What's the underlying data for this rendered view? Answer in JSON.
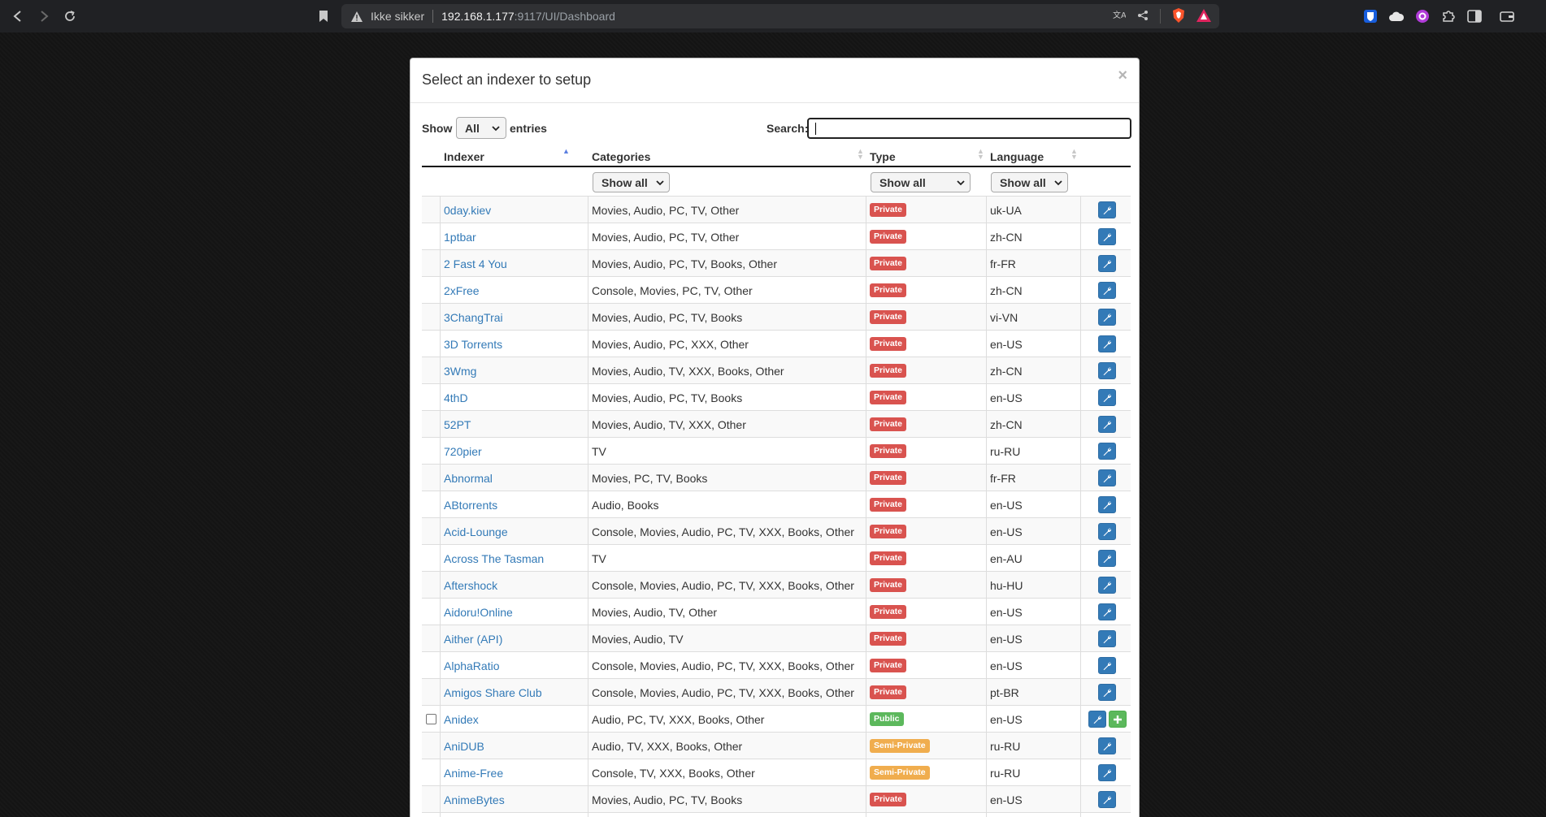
{
  "browser": {
    "security_label": "Ikke sikker",
    "url_host": "192.168.1.177",
    "url_path": ":9117/UI/Dashboard",
    "icons": [
      "back-icon",
      "forward-icon",
      "reload-icon",
      "bookmark-icon",
      "warning-icon",
      "translate-icon",
      "share-icon",
      "brave-shield-icon",
      "brave-rewards-icon",
      "extension-icon",
      "sidebar-icon",
      "wallet-icon"
    ]
  },
  "modal": {
    "title": "Select an indexer to setup",
    "close_label": "×",
    "show_label": "Show",
    "length_value": "All",
    "entries_label": "entries",
    "search_label": "Search:",
    "search_value": ""
  },
  "table": {
    "headers": {
      "indexer": "Indexer",
      "categories": "Categories",
      "type": "Type",
      "language": "Language"
    },
    "filters": {
      "categories": "Show all",
      "type": "Show all",
      "language": "Show all"
    },
    "rows": [
      {
        "name": "0day.kiev",
        "categories": "Movies, Audio, PC, TV, Other",
        "type": "Private",
        "type_key": "private",
        "lang": "uk-UA",
        "selectable": false
      },
      {
        "name": "1ptbar",
        "categories": "Movies, Audio, PC, TV, Other",
        "type": "Private",
        "type_key": "private",
        "lang": "zh-CN",
        "selectable": false
      },
      {
        "name": "2 Fast 4 You",
        "categories": "Movies, Audio, PC, TV, Books, Other",
        "type": "Private",
        "type_key": "private",
        "lang": "fr-FR",
        "selectable": false
      },
      {
        "name": "2xFree",
        "categories": "Console, Movies, PC, TV, Other",
        "type": "Private",
        "type_key": "private",
        "lang": "zh-CN",
        "selectable": false
      },
      {
        "name": "3ChangTrai",
        "categories": "Movies, Audio, PC, TV, Books",
        "type": "Private",
        "type_key": "private",
        "lang": "vi-VN",
        "selectable": false
      },
      {
        "name": "3D Torrents",
        "categories": "Movies, Audio, PC, XXX, Other",
        "type": "Private",
        "type_key": "private",
        "lang": "en-US",
        "selectable": false
      },
      {
        "name": "3Wmg",
        "categories": "Movies, Audio, TV, XXX, Books, Other",
        "type": "Private",
        "type_key": "private",
        "lang": "zh-CN",
        "selectable": false
      },
      {
        "name": "4thD",
        "categories": "Movies, Audio, PC, TV, Books",
        "type": "Private",
        "type_key": "private",
        "lang": "en-US",
        "selectable": false
      },
      {
        "name": "52PT",
        "categories": "Movies, Audio, TV, XXX, Other",
        "type": "Private",
        "type_key": "private",
        "lang": "zh-CN",
        "selectable": false
      },
      {
        "name": "720pier",
        "categories": "TV",
        "type": "Private",
        "type_key": "private",
        "lang": "ru-RU",
        "selectable": false
      },
      {
        "name": "Abnormal",
        "categories": "Movies, PC, TV, Books",
        "type": "Private",
        "type_key": "private",
        "lang": "fr-FR",
        "selectable": false
      },
      {
        "name": "ABtorrents",
        "categories": "Audio, Books",
        "type": "Private",
        "type_key": "private",
        "lang": "en-US",
        "selectable": false
      },
      {
        "name": "Acid-Lounge",
        "categories": "Console, Movies, Audio, PC, TV, XXX, Books, Other",
        "type": "Private",
        "type_key": "private",
        "lang": "en-US",
        "selectable": false
      },
      {
        "name": "Across The Tasman",
        "categories": "TV",
        "type": "Private",
        "type_key": "private",
        "lang": "en-AU",
        "selectable": false
      },
      {
        "name": "Aftershock",
        "categories": "Console, Movies, Audio, PC, TV, XXX, Books, Other",
        "type": "Private",
        "type_key": "private",
        "lang": "hu-HU",
        "selectable": false
      },
      {
        "name": "Aidoru!Online",
        "categories": "Movies, Audio, TV, Other",
        "type": "Private",
        "type_key": "private",
        "lang": "en-US",
        "selectable": false
      },
      {
        "name": "Aither (API)",
        "categories": "Movies, Audio, TV",
        "type": "Private",
        "type_key": "private",
        "lang": "en-US",
        "selectable": false
      },
      {
        "name": "AlphaRatio",
        "categories": "Console, Movies, Audio, PC, TV, XXX, Books, Other",
        "type": "Private",
        "type_key": "private",
        "lang": "en-US",
        "selectable": false
      },
      {
        "name": "Amigos Share Club",
        "categories": "Console, Movies, Audio, PC, TV, XXX, Books, Other",
        "type": "Private",
        "type_key": "private",
        "lang": "pt-BR",
        "selectable": false
      },
      {
        "name": "Anidex",
        "categories": "Audio, PC, TV, XXX, Books, Other",
        "type": "Public",
        "type_key": "public",
        "lang": "en-US",
        "selectable": true
      },
      {
        "name": "AniDUB",
        "categories": "Audio, TV, XXX, Books, Other",
        "type": "Semi-Private",
        "type_key": "semi-private",
        "lang": "ru-RU",
        "selectable": false
      },
      {
        "name": "Anime-Free",
        "categories": "Console, TV, XXX, Books, Other",
        "type": "Semi-Private",
        "type_key": "semi-private",
        "lang": "ru-RU",
        "selectable": false
      },
      {
        "name": "AnimeBytes",
        "categories": "Movies, Audio, PC, TV, Books",
        "type": "Private",
        "type_key": "private",
        "lang": "en-US",
        "selectable": false
      },
      {
        "name": "",
        "categories": "",
        "type": "",
        "type_key": "semi-private",
        "lang": "",
        "selectable": false
      }
    ]
  },
  "colors": {
    "link": "#337ab7",
    "private": "#d9534f",
    "public": "#5cb85c",
    "semi_private": "#f0ad4e",
    "button": "#337ab7",
    "sort_active": "#5b7fe0"
  }
}
